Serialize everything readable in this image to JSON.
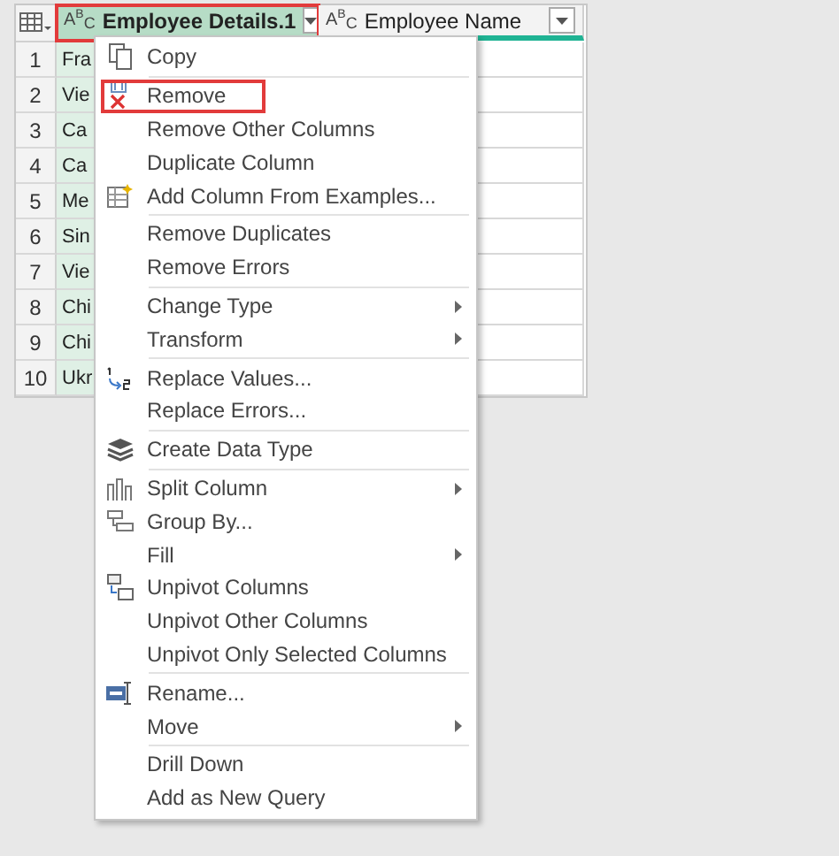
{
  "grid": {
    "columns": [
      {
        "type_label": "A$^{B}$$_{C}$",
        "label": "Employee Details.1",
        "selected": true,
        "highlighted": true
      },
      {
        "type_label": "A$^{B}$$_{C}$",
        "label": "Employee Name",
        "selected": false,
        "highlighted": false
      }
    ],
    "rows": [
      {
        "number": "1",
        "cell": "Fra"
      },
      {
        "number": "2",
        "cell": "Vie"
      },
      {
        "number": "3",
        "cell": "Ca"
      },
      {
        "number": "4",
        "cell": "Ca"
      },
      {
        "number": "5",
        "cell": "Me"
      },
      {
        "number": "6",
        "cell": "Sin"
      },
      {
        "number": "7",
        "cell": "Vie"
      },
      {
        "number": "8",
        "cell": "Chi"
      },
      {
        "number": "9",
        "cell": "Chi"
      },
      {
        "number": "10",
        "cell": "Ukr"
      }
    ]
  },
  "context_menu": {
    "items": [
      {
        "kind": "item",
        "label": "Copy",
        "submenu": false,
        "highlighted": false
      },
      {
        "kind": "separator"
      },
      {
        "kind": "item",
        "label": "Remove",
        "submenu": false,
        "highlighted": true
      },
      {
        "kind": "item",
        "label": "Remove Other Columns",
        "submenu": false,
        "highlighted": false
      },
      {
        "kind": "item",
        "label": "Duplicate Column",
        "submenu": false,
        "highlighted": false
      },
      {
        "kind": "item",
        "label": "Add Column From Examples...",
        "submenu": false,
        "highlighted": false
      },
      {
        "kind": "separator"
      },
      {
        "kind": "item",
        "label": "Remove Duplicates",
        "submenu": false,
        "highlighted": false
      },
      {
        "kind": "item",
        "label": "Remove Errors",
        "submenu": false,
        "highlighted": false
      },
      {
        "kind": "separator"
      },
      {
        "kind": "item",
        "label": "Change Type",
        "submenu": true,
        "highlighted": false
      },
      {
        "kind": "item",
        "label": "Transform",
        "submenu": true,
        "highlighted": false
      },
      {
        "kind": "separator"
      },
      {
        "kind": "item",
        "label": "Replace Values...",
        "submenu": false,
        "highlighted": false
      },
      {
        "kind": "item",
        "label": "Replace Errors...",
        "submenu": false,
        "highlighted": false
      },
      {
        "kind": "separator"
      },
      {
        "kind": "item",
        "label": "Create Data Type",
        "submenu": false,
        "highlighted": false
      },
      {
        "kind": "separator"
      },
      {
        "kind": "item",
        "label": "Split Column",
        "submenu": true,
        "highlighted": false
      },
      {
        "kind": "item",
        "label": "Group By...",
        "submenu": false,
        "highlighted": false
      },
      {
        "kind": "item",
        "label": "Fill",
        "submenu": true,
        "highlighted": false
      },
      {
        "kind": "item",
        "label": "Unpivot Columns",
        "submenu": false,
        "highlighted": false
      },
      {
        "kind": "item",
        "label": "Unpivot Other Columns",
        "submenu": false,
        "highlighted": false
      },
      {
        "kind": "item",
        "label": "Unpivot Only Selected Columns",
        "submenu": false,
        "highlighted": false
      },
      {
        "kind": "separator"
      },
      {
        "kind": "item",
        "label": "Rename...",
        "submenu": false,
        "highlighted": false
      },
      {
        "kind": "item",
        "label": "Move",
        "submenu": true,
        "highlighted": false
      },
      {
        "kind": "separator"
      },
      {
        "kind": "item",
        "label": "Drill Down",
        "submenu": false,
        "highlighted": false
      },
      {
        "kind": "item",
        "label": "Add as New Query",
        "submenu": false,
        "highlighted": false
      }
    ]
  }
}
